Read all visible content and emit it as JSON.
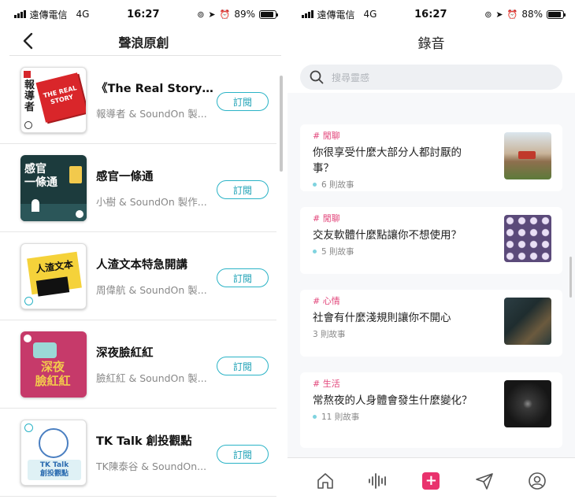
{
  "left": {
    "status": {
      "carrier": "遠傳電信",
      "network": "4G",
      "time": "16:27",
      "battery": "89%",
      "battery_level": 0.89
    },
    "nav": {
      "title": "聲浪原創"
    },
    "podcasts": [
      {
        "title": "《The Real Story》...",
        "subtitle": "報導者 & SoundOn 製...",
        "button": "訂閱",
        "cover_text": [
          "報",
          "導",
          "者"
        ],
        "cover_badge": "THE REAL STORY"
      },
      {
        "title": "感官一條通",
        "subtitle": "小樹 & SoundOn 製作...",
        "button": "訂閱",
        "cover_text": [
          "感官",
          "一條通"
        ]
      },
      {
        "title": "人渣文本特急開講",
        "subtitle": "周偉航 & SoundOn 製...",
        "button": "訂閱",
        "cover_text": [
          "人渣文本"
        ]
      },
      {
        "title": "深夜臉紅紅",
        "subtitle": "臉紅紅 & SoundOn 製...",
        "button": "訂閱",
        "cover_text": [
          "深夜",
          "臉紅紅"
        ]
      },
      {
        "title": "TK Talk 創投觀點",
        "subtitle": "TK陳泰谷 & SoundOn...",
        "button": "訂閱",
        "cover_text": [
          "TK Talk",
          "創投觀點"
        ]
      }
    ]
  },
  "right": {
    "status": {
      "carrier": "遠傳電信",
      "network": "4G",
      "time": "16:27",
      "battery": "88%",
      "battery_level": 0.88
    },
    "nav": {
      "title": "錄音"
    },
    "search": {
      "placeholder": "搜尋靈感"
    },
    "cards": [
      {
        "tag": "# 閒聊",
        "question": "你很享受什麼大部分人都討厭的事？",
        "count": "6 則故事"
      },
      {
        "tag": "# 閒聊",
        "question": "交友軟體什麼點讓你不想使用？",
        "count": "5 則故事"
      },
      {
        "tag": "# 心情",
        "question": "社會有什麼淺規則讓你不開心",
        "count": "3 則故事"
      },
      {
        "tag": "# 生活",
        "question": "常熬夜的人身體會發生什麼變化？",
        "count": "11 則故事"
      }
    ],
    "tabs": [
      "home-icon",
      "waveform-icon",
      "plus-icon",
      "send-icon",
      "profile-icon"
    ],
    "accent": "#e9326d"
  }
}
